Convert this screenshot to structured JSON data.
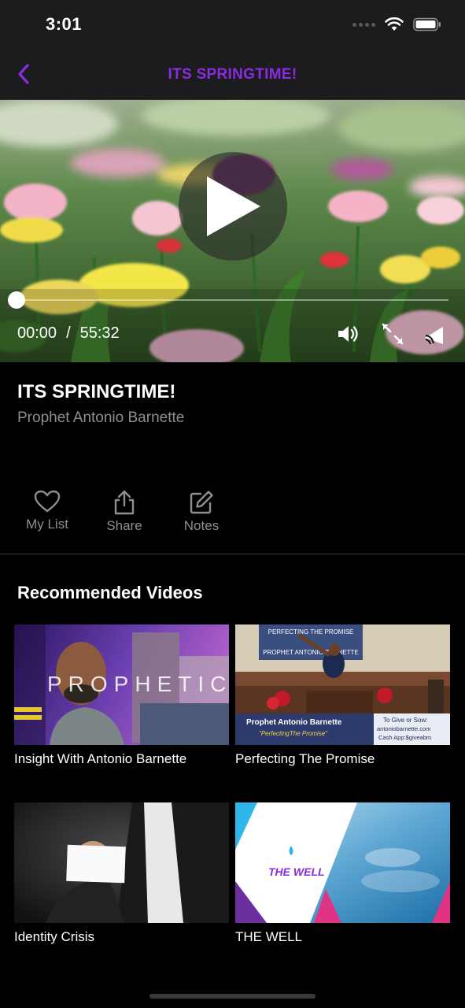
{
  "status": {
    "time": "3:01"
  },
  "nav": {
    "title": "ITS SPRINGTIME!",
    "accent": "#8a2be2"
  },
  "player": {
    "current_time": "00:00",
    "separator": "/",
    "duration": "55:32",
    "progress": 0.0
  },
  "video": {
    "title": "ITS SPRINGTIME!",
    "author": "Prophet Antonio Barnette"
  },
  "actions": [
    {
      "label": "My List",
      "icon": "heart-icon"
    },
    {
      "label": "Share",
      "icon": "share-icon"
    },
    {
      "label": "Notes",
      "icon": "edit-icon"
    }
  ],
  "recommended": {
    "title": "Recommended Videos",
    "items": [
      {
        "label": "Insight With Antonio Barnette",
        "thumb_text": "PROPHETIC"
      },
      {
        "label": "Perfecting The Promise",
        "thumb_text": {
          "screen": "PERFECTING THE PROMISE",
          "screen2": "PROPHET ANTONIO BARNETTE",
          "name": "Prophet Antonio Barnette",
          "subtitle": "\"PerfectingThe Promise\"",
          "give": "To Give or Sow:",
          "site": "antoniobarnette.com",
          "cashapp": "Cash App:$giveabm"
        }
      },
      {
        "label": "Identity Crisis"
      },
      {
        "label": "THE WELL",
        "thumb_text": "THE WELL"
      }
    ]
  }
}
